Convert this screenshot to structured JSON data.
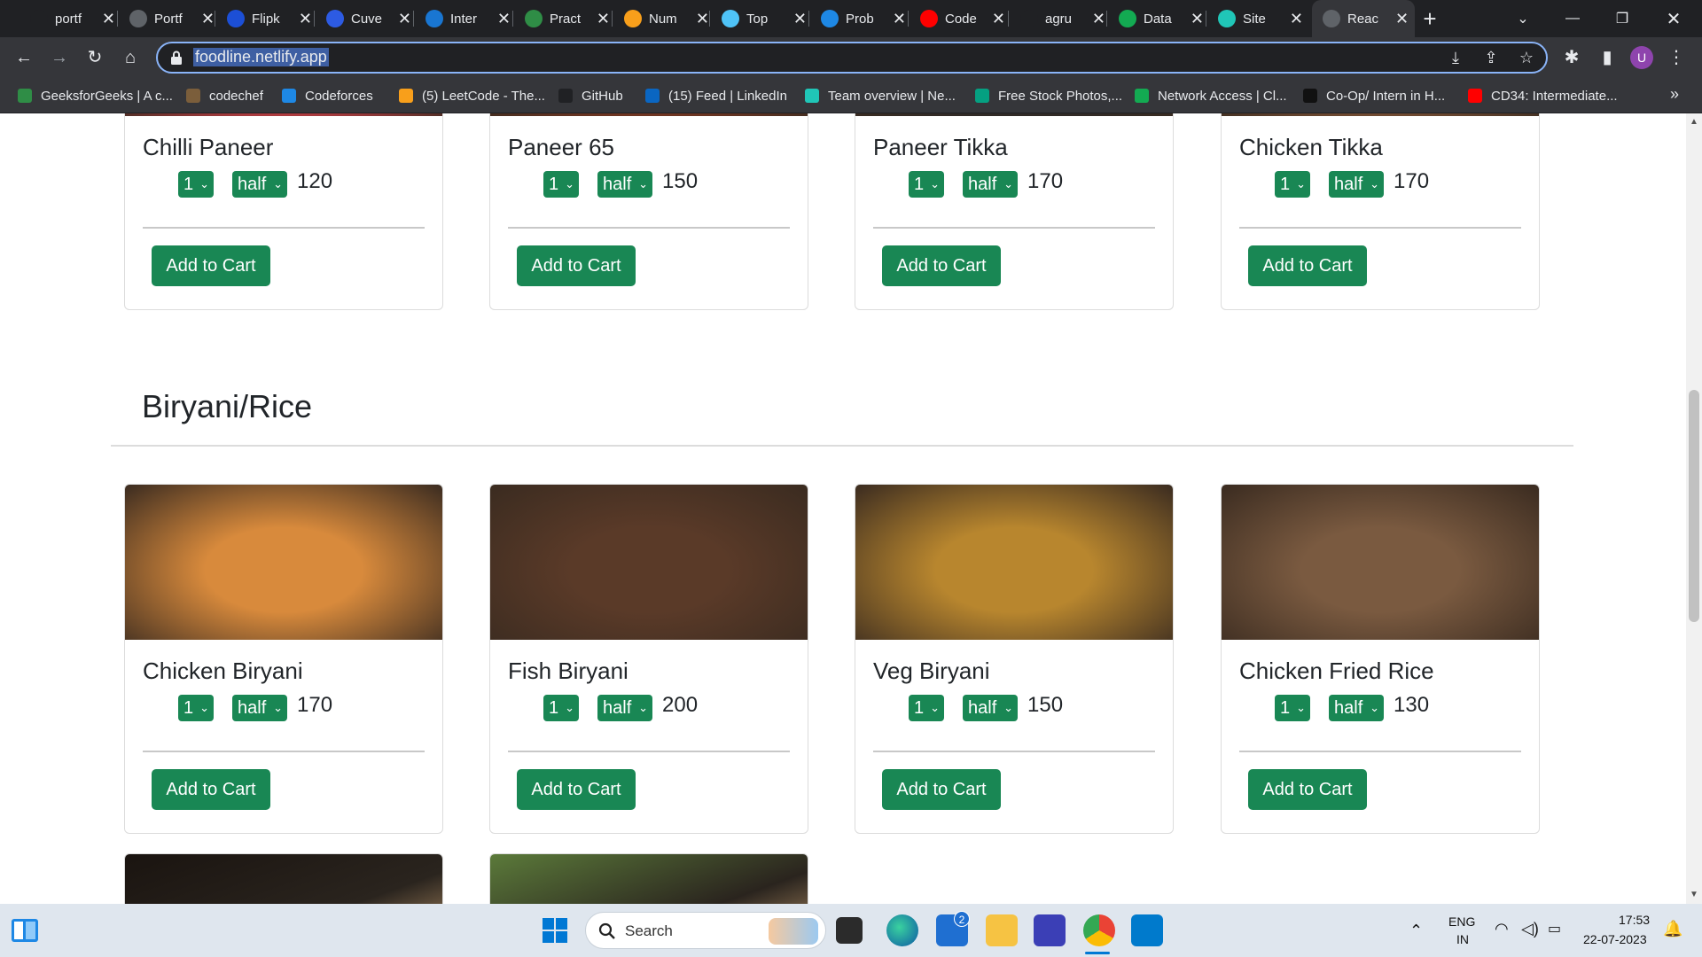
{
  "browser": {
    "tabs": [
      {
        "title": "portf",
        "icon": "github-icon",
        "color": "#202124"
      },
      {
        "title": "Portf",
        "icon": "globe-icon",
        "color": "#5f6368"
      },
      {
        "title": "Flipk",
        "icon": "unstop-icon",
        "color": "#1c4fd6"
      },
      {
        "title": "Cuve",
        "icon": "cuvette-icon",
        "color": "#2d5be3"
      },
      {
        "title": "Inter",
        "icon": "ist-icon",
        "color": "#1976d2"
      },
      {
        "title": "Pract",
        "icon": "gfg-icon",
        "color": "#2f8d46"
      },
      {
        "title": "Num",
        "icon": "leetcode-icon",
        "color": "#f89f1b"
      },
      {
        "title": "Top",
        "icon": "codechef-icon",
        "color": "#4fc3f7"
      },
      {
        "title": "Prob",
        "icon": "codeforces-icon",
        "color": "#1e88e5"
      },
      {
        "title": "Code",
        "icon": "youtube-icon",
        "color": "#ff0000"
      },
      {
        "title": "agru",
        "icon": "github-icon",
        "color": "#202124"
      },
      {
        "title": "Data",
        "icon": "mongodb-icon",
        "color": "#13aa52"
      },
      {
        "title": "Site",
        "icon": "netlify-icon",
        "color": "#20c6b7"
      },
      {
        "title": "Reac",
        "icon": "globe-icon",
        "color": "#5f6368",
        "active": true
      }
    ],
    "url": "foodline.netlify.app",
    "profile_initial": "U",
    "bookmarks": [
      {
        "label": "GeeksforGeeks | A c...",
        "color": "#2f8d46"
      },
      {
        "label": "codechef",
        "color": "#7b5e3b"
      },
      {
        "label": "Codeforces",
        "color": "#1e88e5"
      },
      {
        "label": "(5) LeetCode - The...",
        "color": "#f89f1b"
      },
      {
        "label": "GitHub",
        "color": "#202124"
      },
      {
        "label": "(15) Feed | LinkedIn",
        "color": "#0a66c2"
      },
      {
        "label": "Team overview | Ne...",
        "color": "#20c6b7"
      },
      {
        "label": "Free Stock Photos,...",
        "color": "#05a081"
      },
      {
        "label": "Network Access | Cl...",
        "color": "#13aa52"
      },
      {
        "label": "Co-Op/ Intern in H...",
        "color": "#111111"
      },
      {
        "label": "CD34: Intermediate...",
        "color": "#ff0000"
      }
    ]
  },
  "page": {
    "section_title": "Biryani/Rice",
    "cart_label": "Add to Cart",
    "qty_default": "1",
    "size_default": "half",
    "top_row": [
      {
        "name": "Chilli Paneer",
        "price": "120",
        "img": "#e8434f"
      },
      {
        "name": "Paneer 65",
        "price": "150",
        "img": "#8a3a22"
      },
      {
        "name": "Paneer Tikka",
        "price": "170",
        "img": "#2a2a2a"
      },
      {
        "name": "Chicken Tikka",
        "price": "170",
        "img": "#8b5a3a"
      }
    ],
    "biryani_row": [
      {
        "name": "Chicken Biryani",
        "price": "170",
        "img": "#d88a3c"
      },
      {
        "name": "Fish Biryani",
        "price": "200",
        "img": "#5a3a28"
      },
      {
        "name": "Veg Biryani",
        "price": "150",
        "img": "#b8862e"
      },
      {
        "name": "Chicken Fried Rice",
        "price": "130",
        "img": "#7a5a40"
      }
    ],
    "bottom_row": [
      {
        "img": "#1a1410"
      },
      {
        "img": "#5b7a3a"
      }
    ]
  },
  "taskbar": {
    "search_label": "Search",
    "lang_top": "ENG",
    "lang_bottom": "IN",
    "time": "17:53",
    "date": "22-07-2023",
    "mail_badge": "2"
  }
}
